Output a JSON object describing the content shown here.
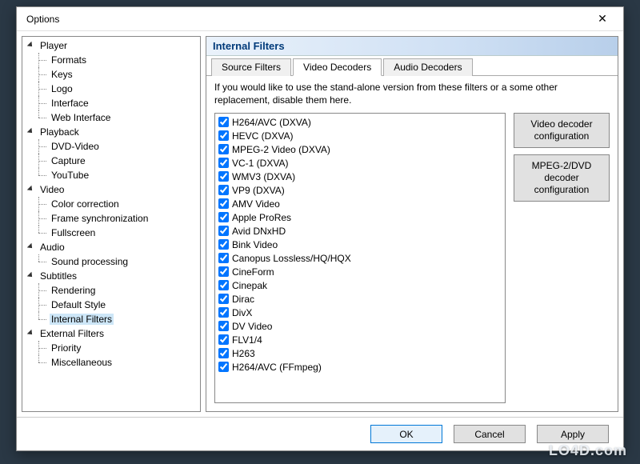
{
  "window": {
    "title": "Options"
  },
  "tree": {
    "categories": [
      {
        "label": "Player",
        "children": [
          "Formats",
          "Keys",
          "Logo",
          "Interface",
          "Web Interface"
        ]
      },
      {
        "label": "Playback",
        "children": [
          "DVD-Video",
          "Capture",
          "YouTube"
        ]
      },
      {
        "label": "Video",
        "children": [
          "Color correction",
          "Frame synchronization",
          "Fullscreen"
        ]
      },
      {
        "label": "Audio",
        "children": [
          "Sound processing"
        ]
      },
      {
        "label": "Subtitles",
        "children": [
          "Rendering",
          "Default Style",
          "Internal Filters"
        ],
        "selected": "Internal Filters"
      },
      {
        "label": "External Filters",
        "children": [
          "Priority",
          "Miscellaneous"
        ]
      }
    ]
  },
  "panel": {
    "title": "Internal Filters",
    "tabs": [
      "Source Filters",
      "Video Decoders",
      "Audio Decoders"
    ],
    "active_tab": 1,
    "description": "If you would like to use the stand-alone version from these filters or a some other replacement, disable them here."
  },
  "codecs": [
    "H264/AVC (DXVA)",
    "HEVC (DXVA)",
    "MPEG-2 Video (DXVA)",
    "VC-1 (DXVA)",
    "WMV3 (DXVA)",
    "VP9 (DXVA)",
    "AMV Video",
    "Apple ProRes",
    "Avid DNxHD",
    "Bink Video",
    "Canopus Lossless/HQ/HQX",
    "CineForm",
    "Cinepak",
    "Dirac",
    "DivX",
    "DV Video",
    "FLV1/4",
    "H263",
    "H264/AVC (FFmpeg)"
  ],
  "side_buttons": {
    "video_decoder_config": "Video decoder configuration",
    "mpeg2_config": "MPEG-2/DVD decoder configuration"
  },
  "footer": {
    "ok": "OK",
    "cancel": "Cancel",
    "apply": "Apply"
  },
  "watermark": "LO4D.com"
}
